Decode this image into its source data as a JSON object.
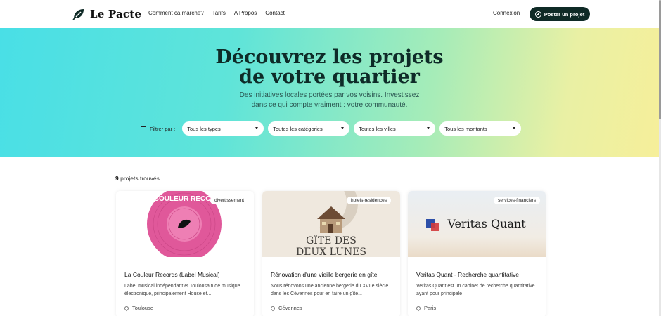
{
  "brand": {
    "name": "Le Pacte"
  },
  "nav": [
    "Comment ca marche?",
    "Tarifs",
    "A Propos",
    "Contact"
  ],
  "header": {
    "login": "Connexion",
    "post_label": "Poster un projet"
  },
  "hero": {
    "title_line1": "Découvrez les projets",
    "title_line2": "de votre quartier",
    "sub_line1": "Des initiatives locales portées par vos voisins. Investissez",
    "sub_line2": "dans ce qui compte vraiment : votre communauté."
  },
  "filters": {
    "label": "Filtrer par :",
    "selects": [
      "Tous les types",
      "Toutes les catégories",
      "Toutes les villes",
      "Tous les montants"
    ]
  },
  "results": {
    "count": "9",
    "count_suffix": "projets trouvés"
  },
  "cards": [
    {
      "tag": "divertissement",
      "image_text": "LA COULEUR RECORDS",
      "title": "La Couleur Records (Label Musical)",
      "desc": "Label musical indépendant et Toulousain de musique électronique, principalement House et...",
      "location": "Toulouse"
    },
    {
      "tag": "hotels-residences",
      "image_text_line1": "GÎTE DES",
      "image_text_line2": "DEUX LUNES",
      "title": "Rénovation d'une vieille bergerie en gîte",
      "desc": "Nous rénovons une ancienne bergerie du XVIIe siècle dans les Cévennes pour en faire un gîte...",
      "location": "Cévennes"
    },
    {
      "tag": "services-financiers",
      "image_text": "Veritas Quant",
      "title": "Veritas Quant - Recherche quantitative",
      "desc": "Veritas Quant est un cabinet de recherche quantitative ayant pour principale",
      "location": "Paris"
    }
  ],
  "colors": {
    "dark": "#0f2a26",
    "pink": "#e0589a",
    "gradient_start": "#49dfe6",
    "gradient_end": "#f6ef9a"
  }
}
